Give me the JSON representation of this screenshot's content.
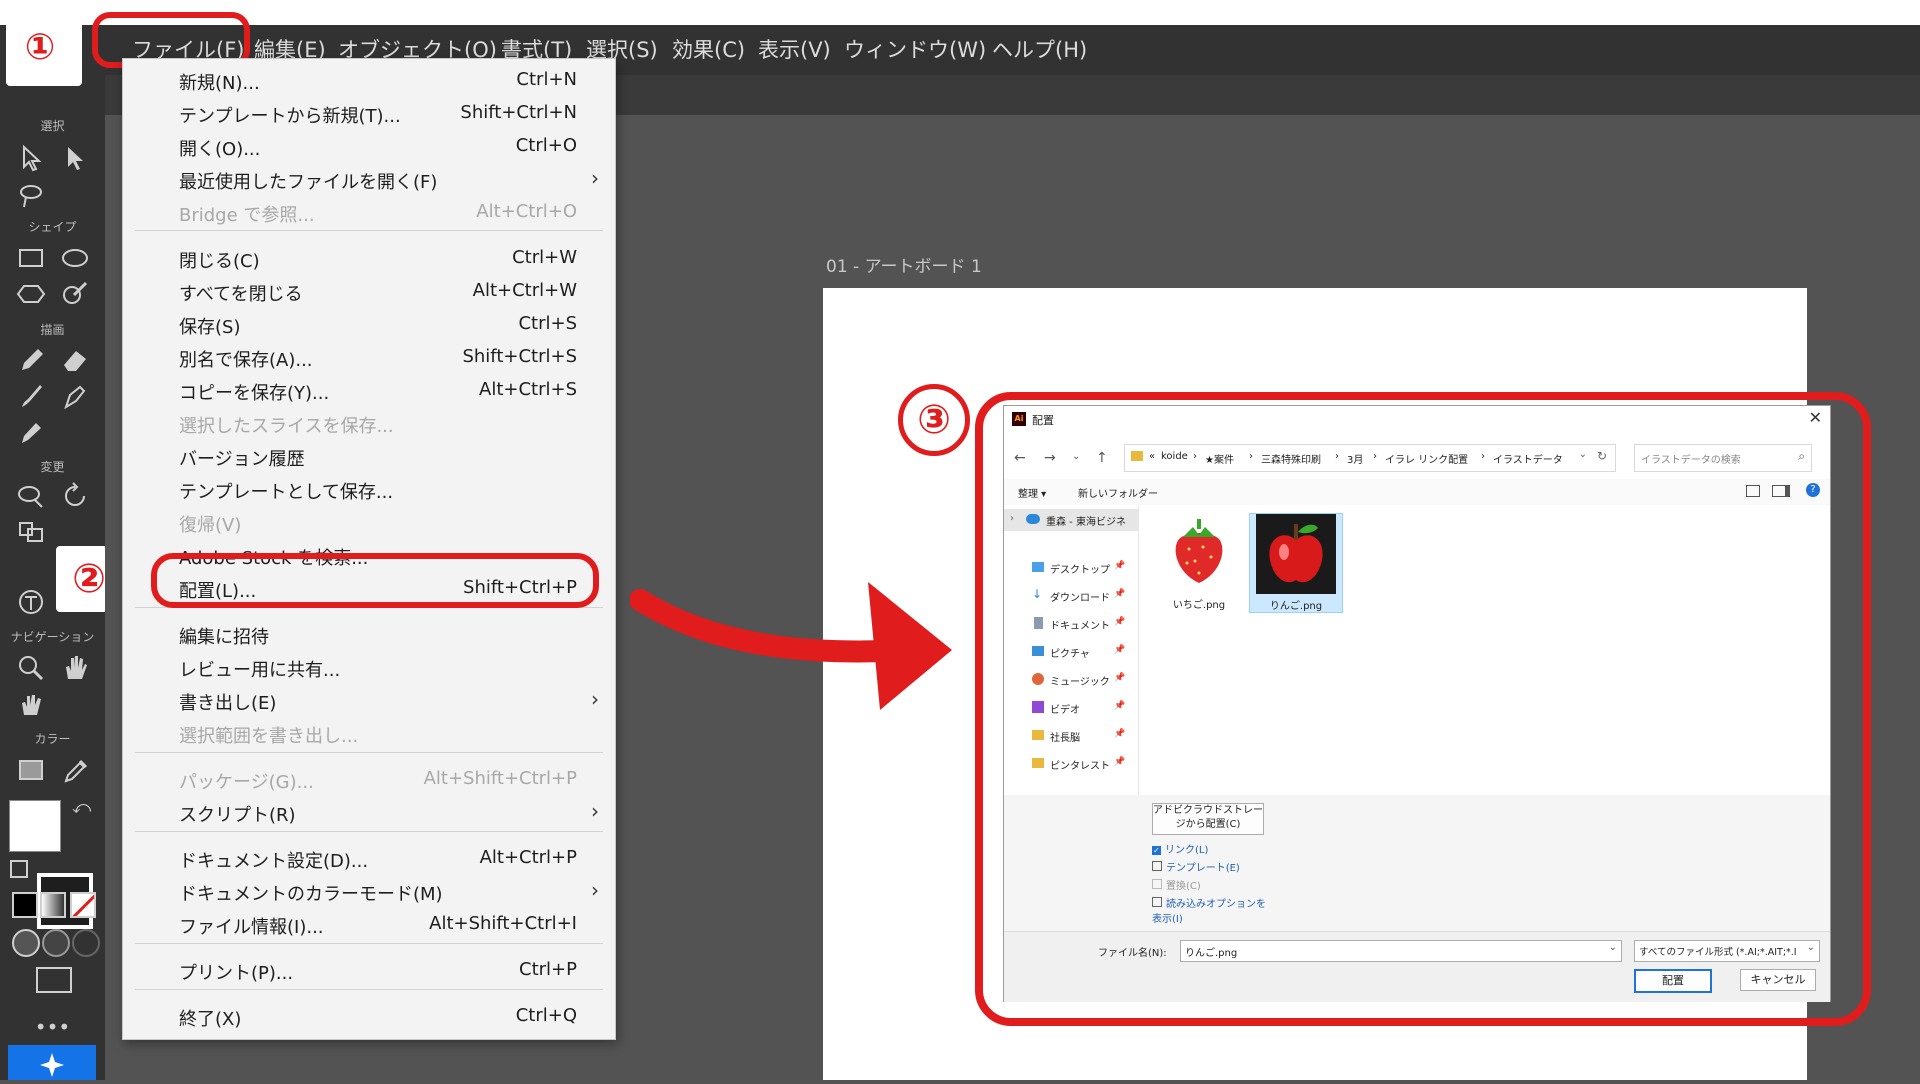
{
  "menubar": {
    "items": [
      "ファイル(F)",
      "編集(E)",
      "オブジェクト(O)",
      "書式(T)",
      "選択(S)",
      "効果(C)",
      "表示(V)",
      "ウィンドウ(W)",
      "ヘルプ(H)"
    ]
  },
  "toolbar": {
    "sections": [
      "選択",
      "シェイプ",
      "描画",
      "変更",
      "文",
      "ナビゲーション",
      "カラー"
    ],
    "more": "•••"
  },
  "file_menu": {
    "items": [
      {
        "label": "新規(N)...",
        "shortcut": "Ctrl+N"
      },
      {
        "label": "テンプレートから新規(T)...",
        "shortcut": "Shift+Ctrl+N"
      },
      {
        "label": "開く(O)...",
        "shortcut": "Ctrl+O"
      },
      {
        "label": "最近使用したファイルを開く(F)",
        "shortcut": ""
      },
      {
        "label": "Bridge で参照...",
        "shortcut": "Alt+Ctrl+O"
      },
      {
        "label": "閉じる(C)",
        "shortcut": "Ctrl+W"
      },
      {
        "label": "すべてを閉じる",
        "shortcut": "Alt+Ctrl+W"
      },
      {
        "label": "保存(S)",
        "shortcut": "Ctrl+S"
      },
      {
        "label": "別名で保存(A)...",
        "shortcut": "Shift+Ctrl+S"
      },
      {
        "label": "コピーを保存(Y)...",
        "shortcut": "Alt+Ctrl+S"
      },
      {
        "label": "選択したスライスを保存...",
        "shortcut": ""
      },
      {
        "label": "バージョン履歴",
        "shortcut": ""
      },
      {
        "label": "テンプレートとして保存...",
        "shortcut": ""
      },
      {
        "label": "復帰(V)",
        "shortcut": ""
      },
      {
        "label": "Adobe Stock を検索...",
        "shortcut": ""
      },
      {
        "label": "配置(L)...",
        "shortcut": "Shift+Ctrl+P"
      },
      {
        "label": "編集に招待",
        "shortcut": ""
      },
      {
        "label": "レビュー用に共有...",
        "shortcut": ""
      },
      {
        "label": "書き出し(E)",
        "shortcut": ""
      },
      {
        "label": "選択範囲を書き出し...",
        "shortcut": ""
      },
      {
        "label": "パッケージ(G)...",
        "shortcut": "Alt+Shift+Ctrl+P"
      },
      {
        "label": "スクリプト(R)",
        "shortcut": ""
      },
      {
        "label": "ドキュメント設定(D)...",
        "shortcut": "Alt+Ctrl+P"
      },
      {
        "label": "ドキュメントのカラーモード(M)",
        "shortcut": ""
      },
      {
        "label": "ファイル情報(I)...",
        "shortcut": "Alt+Shift+Ctrl+I"
      },
      {
        "label": "プリント(P)...",
        "shortcut": "Ctrl+P"
      },
      {
        "label": "終了(X)",
        "shortcut": "Ctrl+Q"
      }
    ]
  },
  "artboard": {
    "label": "01 - アートボード 1"
  },
  "steps": [
    "①",
    "②",
    "③"
  ],
  "dialog": {
    "title": "配置",
    "app_badge": "Ai",
    "breadcrumb": [
      "«",
      "koide",
      "★案件",
      "三森特殊印刷",
      "3月",
      "イラレ リンク配置",
      "イラストデータ"
    ],
    "search_placeholder": "イラストデータの検索",
    "organize": "整理 ▾",
    "new_folder": "新しいフォルダー",
    "cloud_item": "重森 - 東海ビジネ",
    "sidebar": [
      "デスクトップ",
      "ダウンロード",
      "ドキュメント",
      "ピクチャ",
      "ミュージック",
      "ビデオ",
      "社長脳",
      "ピンタレスト"
    ],
    "files": [
      {
        "name": "いちご.png"
      },
      {
        "name": "りんご.png"
      }
    ],
    "cloud_button": "アドビクラウドストレージから配置(C)",
    "options": [
      {
        "label": "リンク(L)",
        "checked": true
      },
      {
        "label": "テンプレート(E)",
        "checked": false
      },
      {
        "label": "置換(C)",
        "checked": false
      },
      {
        "label": "読み込みオプションを表示(I)",
        "checked": false
      }
    ],
    "filename_label": "ファイル名(N):",
    "filename_value": "りんご.png",
    "filetype": "すべてのファイル形式 (*.AI;*.AIT;*.I",
    "place_button": "配置",
    "cancel_button": "キャンセル"
  },
  "colors": {
    "accent_red": "#e01c1c",
    "app_dark": "#323232",
    "selection_blue": "#cce8ff"
  }
}
